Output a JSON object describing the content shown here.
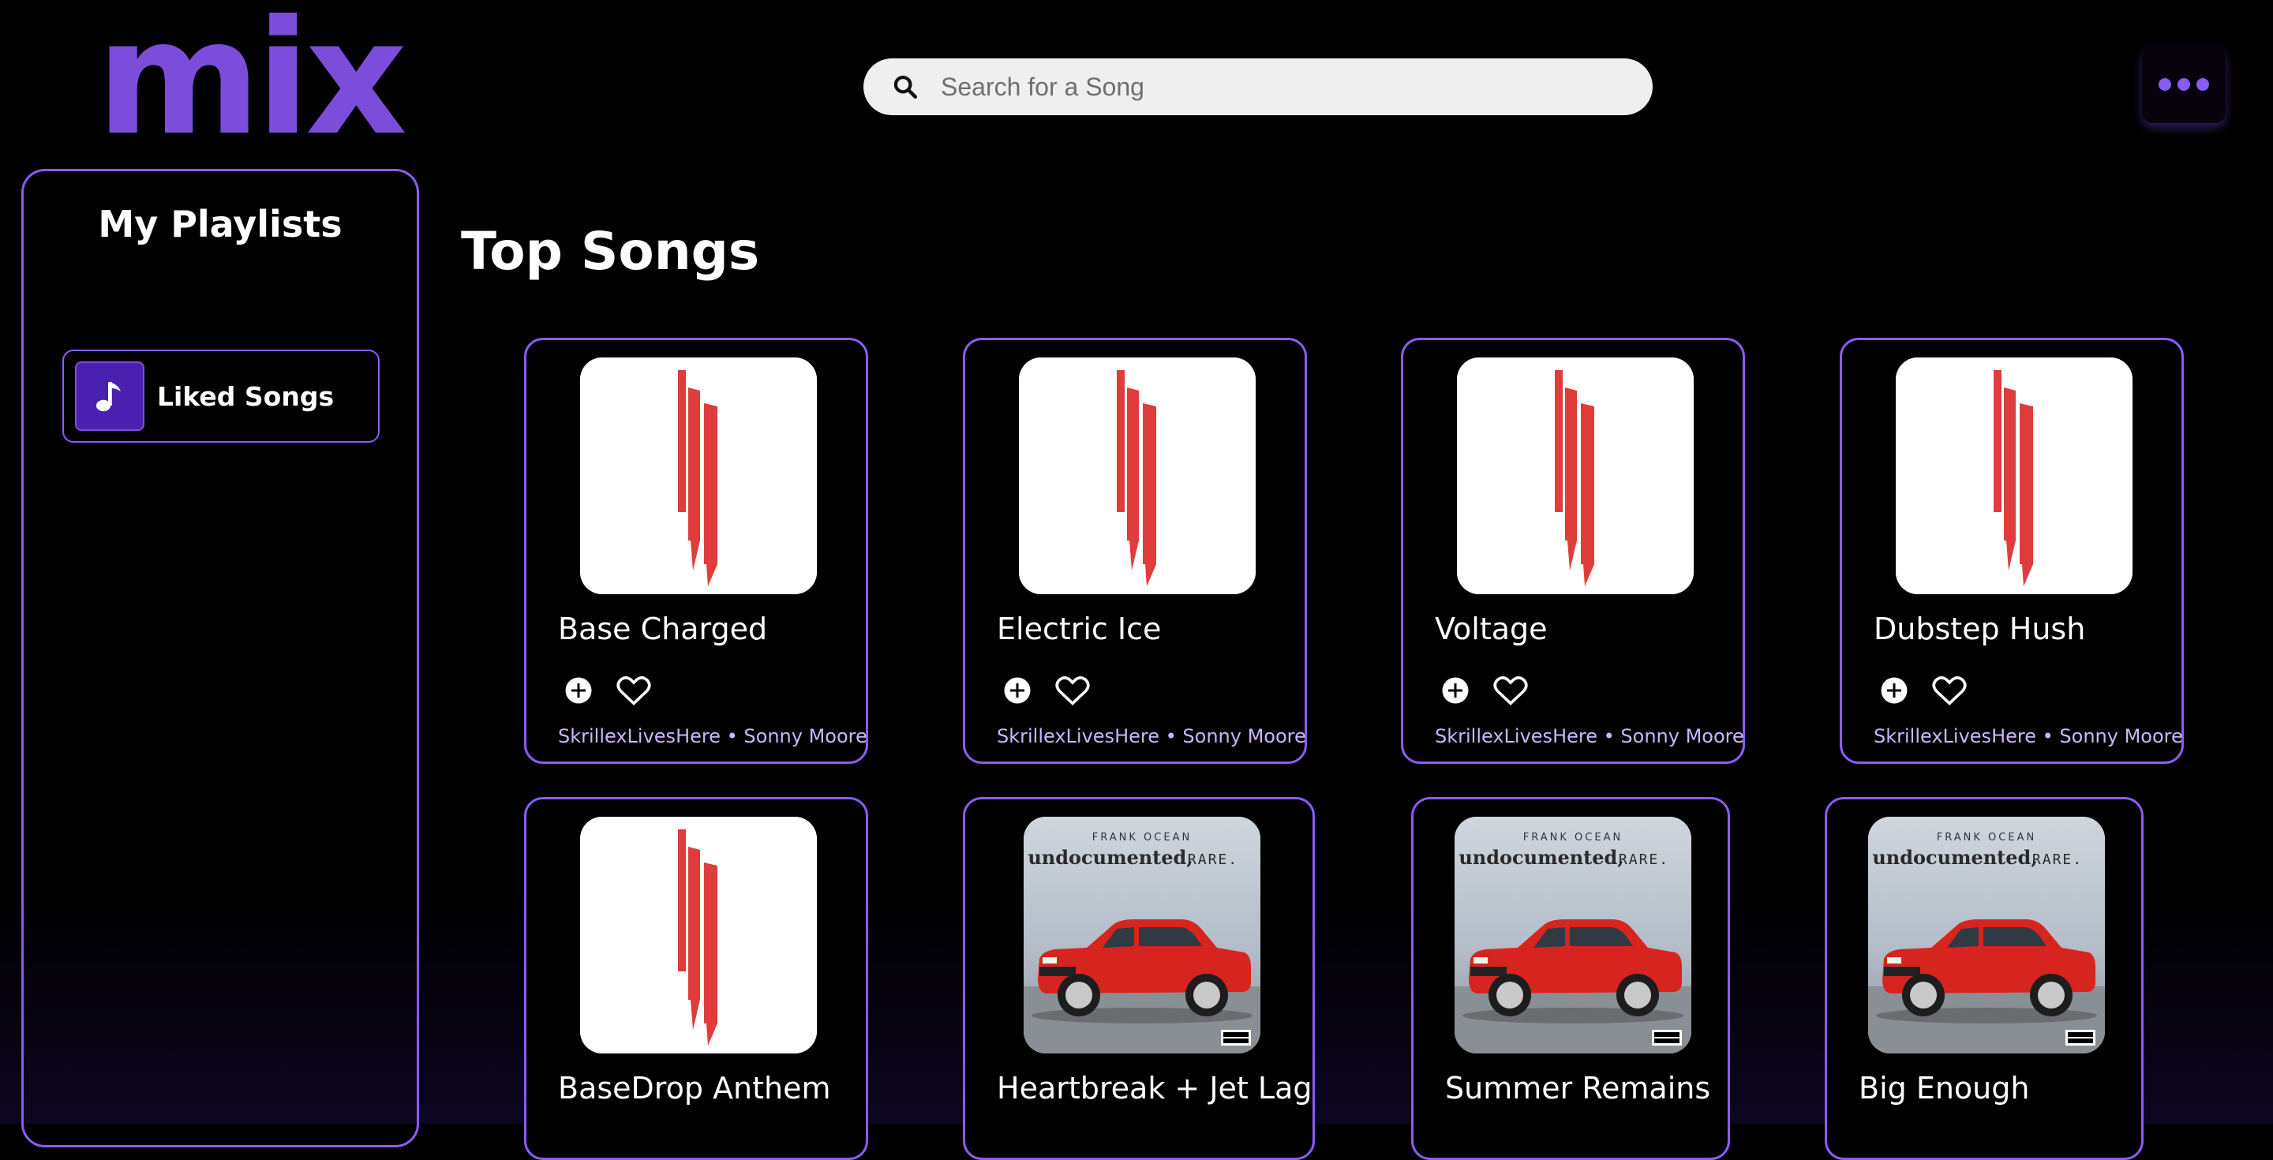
{
  "app": {
    "logo": "mix"
  },
  "search": {
    "placeholder": "Search for a Song",
    "icon": "search-icon"
  },
  "menu": {
    "icon": "more-icon"
  },
  "colors": {
    "accent": "#8a5cf6",
    "logo": "#7c4ddb",
    "artist_text": "#cbb6f8",
    "skrillex_red": "#e03c3c"
  },
  "sidebar": {
    "title": "My Playlists",
    "items": [
      {
        "label": "Liked Songs",
        "icon": "music-note-icon"
      }
    ]
  },
  "main": {
    "heading": "Top Songs",
    "songs": [
      {
        "title": "Base Charged",
        "artist": "SkrillexLivesHere • Sonny Moore",
        "cover": "skrillex-logo"
      },
      {
        "title": "Electric Ice",
        "artist": "SkrillexLivesHere • Sonny Moore",
        "cover": "skrillex-logo"
      },
      {
        "title": "Voltage",
        "artist": "SkrillexLivesHere • Sonny Moore",
        "cover": "skrillex-logo"
      },
      {
        "title": "Dubstep Hush",
        "artist": "SkrillexLivesHere • Sonny Moore",
        "cover": "skrillex-logo"
      },
      {
        "title": "BaseDrop Anthem",
        "cover": "skrillex-logo"
      },
      {
        "title": "Heartbreak + Jet Lag",
        "cover": "frank-ocean-undocumented-rare",
        "cover_text": {
          "artist": "FRANK OCEAN",
          "album": "undocumented,",
          "album2": "RARE."
        }
      },
      {
        "title": "Summer Remains",
        "cover": "frank-ocean-undocumented-rare",
        "cover_text": {
          "artist": "FRANK OCEAN",
          "album": "undocumented,",
          "album2": "RARE."
        }
      },
      {
        "title": "Big Enough",
        "cover": "frank-ocean-undocumented-rare",
        "cover_text": {
          "artist": "FRANK OCEAN",
          "album": "undocumented,",
          "album2": "RARE."
        }
      }
    ]
  }
}
